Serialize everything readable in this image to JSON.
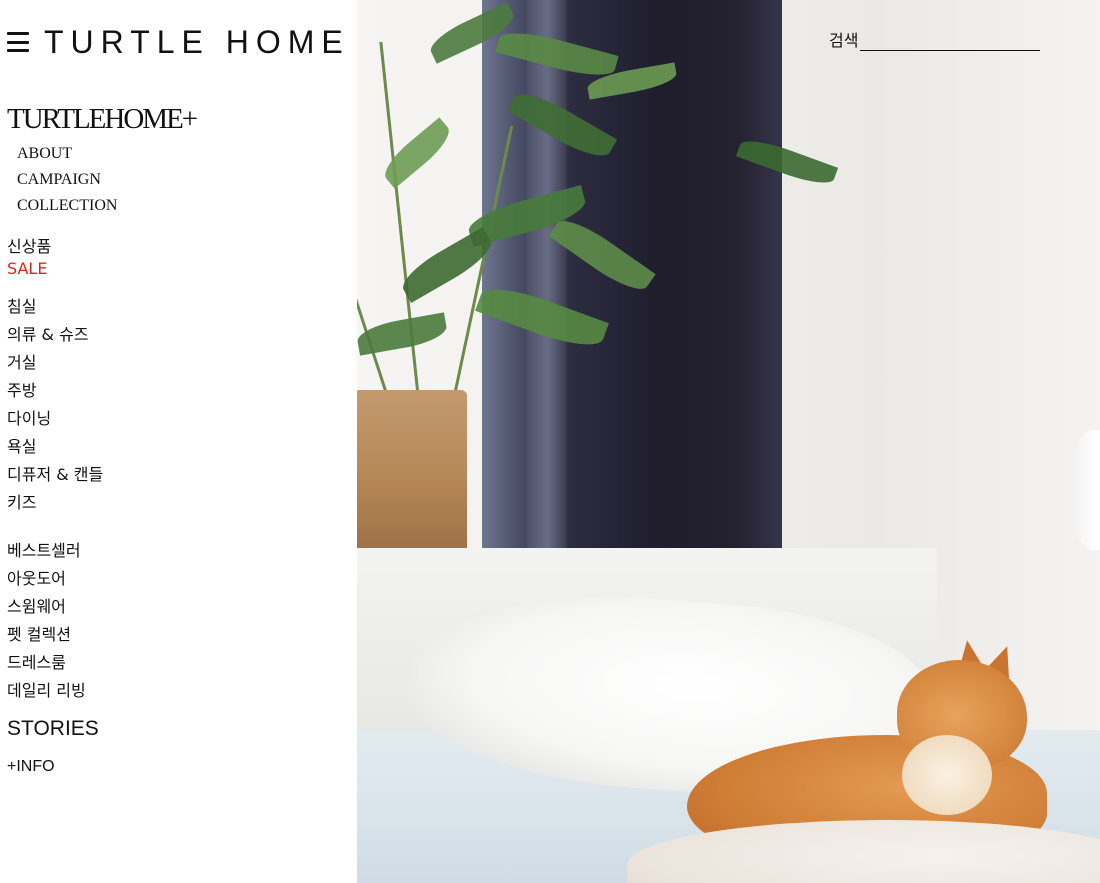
{
  "header": {
    "brand": "TURTLE HOME",
    "menu_icon": "hamburger-icon"
  },
  "sidebar": {
    "plus_logo": "TURTLEHOME+",
    "serif_menu": [
      "ABOUT",
      "CAMPAIGN",
      "COLLECTION"
    ],
    "top_links": [
      {
        "label": "신상품"
      },
      {
        "label": "SALE",
        "color": "#e2231a"
      }
    ],
    "categories": [
      "침실",
      "의류 & 슈즈",
      "거실",
      "주방",
      "다이닝",
      "욕실",
      "디퓨저 & 캔들",
      "키즈"
    ],
    "featured": [
      "베스트셀러",
      "아웃도어",
      "스윔웨어",
      "펫 컬렉션",
      "드레스룸",
      "데일리 리빙"
    ],
    "stories": "STORIES",
    "info": "+INFO"
  },
  "search": {
    "label": "검색",
    "value": ""
  },
  "hero": {
    "subject": "orange tabby cat lying on a bed beside a potted plant and dark curtain"
  }
}
